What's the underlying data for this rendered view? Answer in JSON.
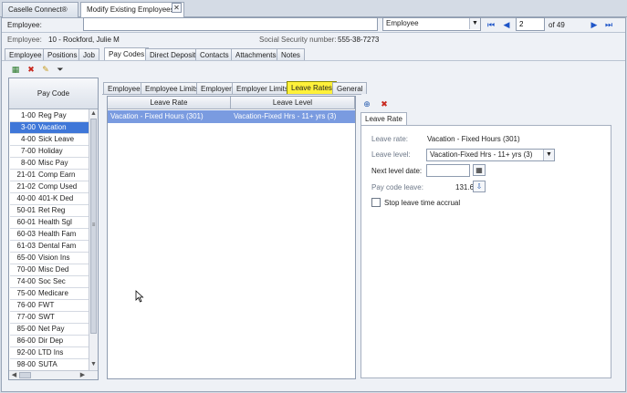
{
  "app_tabs": [
    {
      "label": "Caselle Connect®"
    },
    {
      "label": "Modify Existing Employees"
    }
  ],
  "top": {
    "employee_label": "Employee:",
    "employee_value": "",
    "lookup_type": "Employee",
    "record_current": "2",
    "record_total": "of 49"
  },
  "info": {
    "employee_label": "Employee:",
    "employee_value": "10 - Rockford, Julie M",
    "ssn_label": "Social Security number:",
    "ssn_value": "555-38-7273"
  },
  "main_tabs": [
    {
      "label": "Employee"
    },
    {
      "label": "Positions"
    },
    {
      "label": "Job"
    },
    {
      "label": "Pay Codes"
    },
    {
      "label": "Direct Deposit"
    },
    {
      "label": "Contacts"
    },
    {
      "label": "Attachments"
    },
    {
      "label": "Notes"
    }
  ],
  "pay_codes": {
    "header": "Pay Code",
    "items": [
      {
        "code": "1-00",
        "name": "Reg Pay"
      },
      {
        "code": "3-00",
        "name": "Vacation"
      },
      {
        "code": "4-00",
        "name": "Sick Leave"
      },
      {
        "code": "7-00",
        "name": "Holiday"
      },
      {
        "code": "8-00",
        "name": "Misc Pay"
      },
      {
        "code": "21-01",
        "name": "Comp Earn"
      },
      {
        "code": "21-02",
        "name": "Comp Used"
      },
      {
        "code": "40-00",
        "name": "401-K Ded"
      },
      {
        "code": "50-01",
        "name": "Ret Reg"
      },
      {
        "code": "60-01",
        "name": "Health Sgl"
      },
      {
        "code": "60-03",
        "name": "Health Fam"
      },
      {
        "code": "61-03",
        "name": "Dental Fam"
      },
      {
        "code": "65-00",
        "name": "Vision Ins"
      },
      {
        "code": "70-00",
        "name": "Misc Ded"
      },
      {
        "code": "74-00",
        "name": "Soc Sec"
      },
      {
        "code": "75-00",
        "name": "Medicare"
      },
      {
        "code": "76-00",
        "name": "FWT"
      },
      {
        "code": "77-00",
        "name": "SWT"
      },
      {
        "code": "85-00",
        "name": "Net Pay"
      },
      {
        "code": "86-00",
        "name": "Dir Dep"
      },
      {
        "code": "92-00",
        "name": "LTD Ins"
      },
      {
        "code": "98-00",
        "name": "SUTA"
      }
    ]
  },
  "sub_tabs": [
    {
      "label": "Employee"
    },
    {
      "label": "Employee Limits"
    },
    {
      "label": "Employer"
    },
    {
      "label": "Employer Limits"
    },
    {
      "label": "Leave Rates"
    },
    {
      "label": "General"
    }
  ],
  "leave_grid": {
    "columns": [
      "Leave Rate",
      "Leave Level"
    ],
    "rows": [
      {
        "rate": "Vacation - Fixed Hours (301)",
        "level": "Vacation-Fixed Hrs - 11+ yrs (3)"
      }
    ]
  },
  "detail": {
    "tab": "Leave Rate",
    "leave_rate_label": "Leave rate:",
    "leave_rate_value": "Vacation - Fixed Hours (301)",
    "leave_level_label": "Leave level:",
    "leave_level_value": "Vacation-Fixed Hrs - 11+ yrs (3)",
    "next_level_label": "Next level date:",
    "next_level_value": "",
    "pay_code_leave_label": "Pay code leave:",
    "pay_code_leave_value": "131.60",
    "stop_accrual_label": "Stop leave time accrual",
    "stop_accrual_checked": false
  },
  "colors": {
    "selection": "#3f77d8",
    "grid_selection": "#7a9be0",
    "highlight_tab": "#fff13a"
  }
}
